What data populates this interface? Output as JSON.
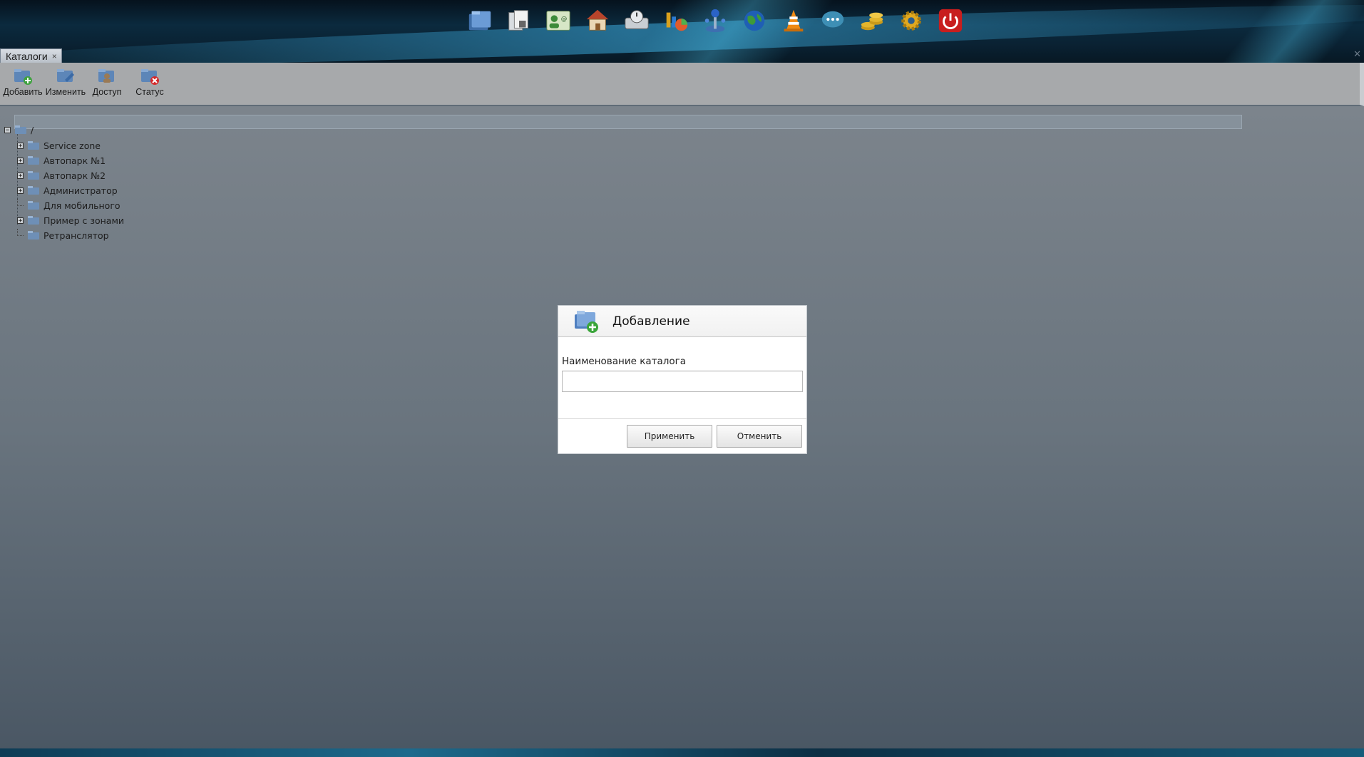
{
  "dock": {
    "icons": [
      "folders-icon",
      "documents-icon",
      "contact-card-icon",
      "house-icon",
      "hard-drive-icon",
      "pie-chart-icon",
      "joystick-icon",
      "globe-icon",
      "traffic-cone-icon",
      "chat-bubble-icon",
      "coins-icon",
      "gear-icon",
      "power-icon"
    ]
  },
  "tab": {
    "label": "Каталоги",
    "close": "×"
  },
  "toolbar": {
    "add_label": "Добавить",
    "edit_label": "Изменить",
    "access_label": "Доступ",
    "status_label": "Статус"
  },
  "tree": {
    "root": "/",
    "items": [
      {
        "label": "Service zone",
        "expandable": true
      },
      {
        "label": "Автопарк №1",
        "expandable": true
      },
      {
        "label": "Автопарк №2",
        "expandable": true
      },
      {
        "label": "Администратор",
        "expandable": true
      },
      {
        "label": "Для мобильного",
        "expandable": false
      },
      {
        "label": "Пример с зонами",
        "expandable": true
      },
      {
        "label": "Ретранслятор",
        "expandable": false
      }
    ],
    "expand_glyph": "+",
    "collapse_glyph": "−"
  },
  "dialog": {
    "title": "Добавление",
    "field_label": "Наименование каталога",
    "field_value": "",
    "apply_label": "Применить",
    "cancel_label": "Отменить"
  },
  "colors": {
    "overlay": "#6d7781",
    "dialog_bg": "#ffffff",
    "dock_bg": "#0b2a3e"
  }
}
